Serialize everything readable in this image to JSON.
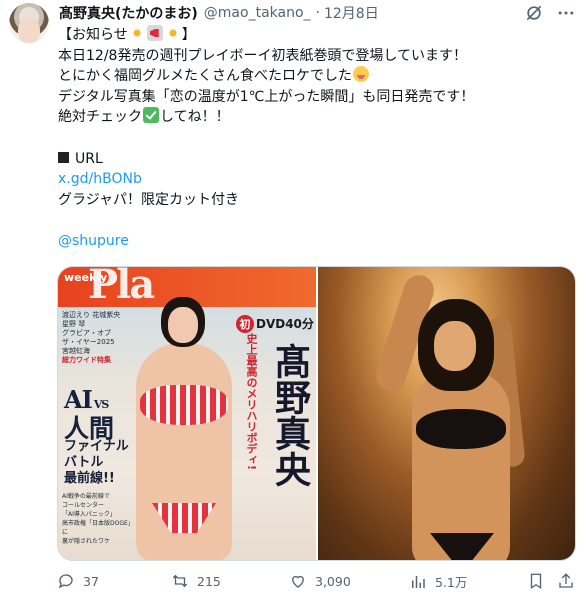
{
  "tweet": {
    "author": {
      "display_name": "髙野真央(たかのまお)",
      "handle": "@mao_takano_",
      "separator": "·",
      "date": "12月8日"
    },
    "lines": [
      {
        "text": "【お知らせ",
        "suffix": "】"
      },
      {
        "text": "本日12/8発売の週刊プレイボーイ初表紙巻頭で登場しています！"
      },
      {
        "text": "とにかく福岡グルメたくさん食べたロケでした"
      },
      {
        "text": "デジタル写真集「恋の温度が1℃上がった瞬間」も同日発売です！"
      },
      {
        "text": "絶対チェック",
        "suffix": "してね！！"
      },
      {
        "text": ""
      },
      {
        "text": "URL"
      },
      {
        "text": "x.gd/hBONb"
      },
      {
        "text": "グラジャパ！限定カット付き"
      },
      {
        "text": ""
      },
      {
        "text": "@shupure"
      }
    ],
    "emoji": {
      "sparkle": "sparkle-emoji",
      "megaphone": "megaphone-emoji",
      "yum": "yum-face-emoji",
      "check": "check-mark-emoji"
    }
  },
  "media": {
    "cover": {
      "logo_small": "weekly",
      "logo_big": "Pla",
      "headline_lines": [
        "渡辺えり 花城紫央",
        "星野 琴",
        "グラビア・オブ",
        "ザ・イヤー2025",
        "宮越虹海"
      ],
      "feature_label": "総力ワイド特集",
      "ai": "AI",
      "vs": "VS",
      "jinkan": "人間",
      "final": [
        "ファイナル",
        "バトル",
        "最前線!!"
      ],
      "small_lines": [
        "AI戦争の最前線で",
        "コールセンター",
        "「AI導入パニック」",
        "高市政権「日本版DOGE」に",
        "裏が隠されたワケ"
      ],
      "badge": "初",
      "dvd": "DVD40分",
      "tagline": "史上最高のメリハリボディ!",
      "cover_name": "髙野真央"
    }
  },
  "actions": {
    "replies": "37",
    "reposts": "215",
    "likes": "3,090",
    "views": "5.1万"
  },
  "colors": {
    "text": "#0f1419",
    "muted": "#536471",
    "link": "#1d9bf0",
    "border": "#cfd9de"
  }
}
